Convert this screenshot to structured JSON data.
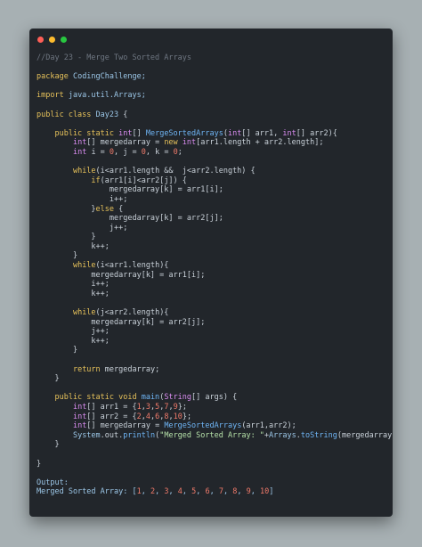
{
  "window": {
    "controls": [
      "close",
      "minimize",
      "maximize"
    ]
  },
  "code": {
    "lines": [
      [
        {
          "t": "//Day 23 - Merge Two Sorted Arrays",
          "c": "cm"
        }
      ],
      [],
      [
        {
          "t": "package ",
          "c": "kw"
        },
        {
          "t": "CodingChallenge;",
          "c": "pl"
        }
      ],
      [],
      [
        {
          "t": "import ",
          "c": "kw"
        },
        {
          "t": "java.util.Arrays;",
          "c": "pl"
        }
      ],
      [],
      [
        {
          "t": "public class ",
          "c": "kw"
        },
        {
          "t": "Day23 ",
          "c": "pl"
        },
        {
          "t": "{",
          "c": "sy"
        }
      ],
      [],
      [
        {
          "t": "    public static ",
          "c": "kw"
        },
        {
          "t": "int",
          "c": "ty"
        },
        {
          "t": "[] ",
          "c": "sy"
        },
        {
          "t": "MergeSortedArrays",
          "c": "fn"
        },
        {
          "t": "(",
          "c": "sy"
        },
        {
          "t": "int",
          "c": "ty"
        },
        {
          "t": "[] arr1, ",
          "c": "sy"
        },
        {
          "t": "int",
          "c": "ty"
        },
        {
          "t": "[] arr2){",
          "c": "sy"
        }
      ],
      [
        {
          "t": "        ",
          "c": "sy"
        },
        {
          "t": "int",
          "c": "ty"
        },
        {
          "t": "[] mergedarray = ",
          "c": "sy"
        },
        {
          "t": "new ",
          "c": "kw"
        },
        {
          "t": "int",
          "c": "ty"
        },
        {
          "t": "[arr1.length + arr2.length];",
          "c": "sy"
        }
      ],
      [
        {
          "t": "        ",
          "c": "sy"
        },
        {
          "t": "int ",
          "c": "ty"
        },
        {
          "t": "i = ",
          "c": "sy"
        },
        {
          "t": "0",
          "c": "nm"
        },
        {
          "t": ", j = ",
          "c": "sy"
        },
        {
          "t": "0",
          "c": "nm"
        },
        {
          "t": ", k = ",
          "c": "sy"
        },
        {
          "t": "0",
          "c": "nm"
        },
        {
          "t": ";",
          "c": "sy"
        }
      ],
      [],
      [
        {
          "t": "        ",
          "c": "sy"
        },
        {
          "t": "while",
          "c": "kw"
        },
        {
          "t": "(i<arr1.length &&  j<arr2.length) {",
          "c": "sy"
        }
      ],
      [
        {
          "t": "            ",
          "c": "sy"
        },
        {
          "t": "if",
          "c": "kw"
        },
        {
          "t": "(arr1[i]<arr2[j]) {",
          "c": "sy"
        }
      ],
      [
        {
          "t": "                mergedarray[k] = arr1[i];",
          "c": "sy"
        }
      ],
      [
        {
          "t": "                i++;",
          "c": "sy"
        }
      ],
      [
        {
          "t": "            }",
          "c": "sy"
        },
        {
          "t": "else",
          "c": "kw"
        },
        {
          "t": " {",
          "c": "sy"
        }
      ],
      [
        {
          "t": "                mergedarray[k] = arr2[j];",
          "c": "sy"
        }
      ],
      [
        {
          "t": "                j++;",
          "c": "sy"
        }
      ],
      [
        {
          "t": "            }",
          "c": "sy"
        }
      ],
      [
        {
          "t": "            k++;",
          "c": "sy"
        }
      ],
      [
        {
          "t": "        }",
          "c": "sy"
        }
      ],
      [
        {
          "t": "        ",
          "c": "sy"
        },
        {
          "t": "while",
          "c": "kw"
        },
        {
          "t": "(i<arr1.length){",
          "c": "sy"
        }
      ],
      [
        {
          "t": "            mergedarray[k] = arr1[i];",
          "c": "sy"
        }
      ],
      [
        {
          "t": "            i++;",
          "c": "sy"
        }
      ],
      [
        {
          "t": "            k++;",
          "c": "sy"
        }
      ],
      [],
      [
        {
          "t": "        ",
          "c": "sy"
        },
        {
          "t": "while",
          "c": "kw"
        },
        {
          "t": "(j<arr2.length){",
          "c": "sy"
        }
      ],
      [
        {
          "t": "            mergedarray[k] = arr2[j];",
          "c": "sy"
        }
      ],
      [
        {
          "t": "            j++;",
          "c": "sy"
        }
      ],
      [
        {
          "t": "            k++;",
          "c": "sy"
        }
      ],
      [
        {
          "t": "        }",
          "c": "sy"
        }
      ],
      [],
      [
        {
          "t": "        ",
          "c": "sy"
        },
        {
          "t": "return ",
          "c": "kw"
        },
        {
          "t": "mergedarray;",
          "c": "sy"
        }
      ],
      [
        {
          "t": "    }",
          "c": "sy"
        }
      ],
      [],
      [
        {
          "t": "    public static void ",
          "c": "kw"
        },
        {
          "t": "main",
          "c": "fn"
        },
        {
          "t": "(",
          "c": "sy"
        },
        {
          "t": "String",
          "c": "ty"
        },
        {
          "t": "[] args) {",
          "c": "sy"
        }
      ],
      [
        {
          "t": "        ",
          "c": "sy"
        },
        {
          "t": "int",
          "c": "ty"
        },
        {
          "t": "[] arr1 = {",
          "c": "sy"
        },
        {
          "t": "1",
          "c": "nm"
        },
        {
          "t": ",",
          "c": "sy"
        },
        {
          "t": "3",
          "c": "nm"
        },
        {
          "t": ",",
          "c": "sy"
        },
        {
          "t": "5",
          "c": "nm"
        },
        {
          "t": ",",
          "c": "sy"
        },
        {
          "t": "7",
          "c": "nm"
        },
        {
          "t": ",",
          "c": "sy"
        },
        {
          "t": "9",
          "c": "nm"
        },
        {
          "t": "};",
          "c": "sy"
        }
      ],
      [
        {
          "t": "        ",
          "c": "sy"
        },
        {
          "t": "int",
          "c": "ty"
        },
        {
          "t": "[] arr2 = {",
          "c": "sy"
        },
        {
          "t": "2",
          "c": "nm"
        },
        {
          "t": ",",
          "c": "sy"
        },
        {
          "t": "4",
          "c": "nm"
        },
        {
          "t": ",",
          "c": "sy"
        },
        {
          "t": "6",
          "c": "nm"
        },
        {
          "t": ",",
          "c": "sy"
        },
        {
          "t": "8",
          "c": "nm"
        },
        {
          "t": ",",
          "c": "sy"
        },
        {
          "t": "10",
          "c": "nm"
        },
        {
          "t": "};",
          "c": "sy"
        }
      ],
      [
        {
          "t": "        ",
          "c": "sy"
        },
        {
          "t": "int",
          "c": "ty"
        },
        {
          "t": "[] mergedarray = ",
          "c": "sy"
        },
        {
          "t": "MergeSortedArrays",
          "c": "fn"
        },
        {
          "t": "(arr1,arr2);",
          "c": "sy"
        }
      ],
      [
        {
          "t": "        ",
          "c": "sy"
        },
        {
          "t": "System",
          "c": "pl"
        },
        {
          "t": ".out.",
          "c": "sy"
        },
        {
          "t": "println",
          "c": "fn"
        },
        {
          "t": "(",
          "c": "sy"
        },
        {
          "t": "\"Merged Sorted Array: \"",
          "c": "st"
        },
        {
          "t": "+",
          "c": "sy"
        },
        {
          "t": "Arrays",
          "c": "pl"
        },
        {
          "t": ".",
          "c": "sy"
        },
        {
          "t": "toString",
          "c": "fn"
        },
        {
          "t": "(mergedarray));",
          "c": "sy"
        }
      ],
      [
        {
          "t": "    }",
          "c": "sy"
        }
      ],
      [],
      [
        {
          "t": "}",
          "c": "sy"
        }
      ],
      [],
      [
        {
          "t": "Output:",
          "c": "pl"
        }
      ],
      [
        {
          "t": "Merged Sorted Array: [",
          "c": "pl"
        },
        {
          "t": "1",
          "c": "nm"
        },
        {
          "t": ", ",
          "c": "pl"
        },
        {
          "t": "2",
          "c": "nm"
        },
        {
          "t": ", ",
          "c": "pl"
        },
        {
          "t": "3",
          "c": "nm"
        },
        {
          "t": ", ",
          "c": "pl"
        },
        {
          "t": "4",
          "c": "nm"
        },
        {
          "t": ", ",
          "c": "pl"
        },
        {
          "t": "5",
          "c": "nm"
        },
        {
          "t": ", ",
          "c": "pl"
        },
        {
          "t": "6",
          "c": "nm"
        },
        {
          "t": ", ",
          "c": "pl"
        },
        {
          "t": "7",
          "c": "nm"
        },
        {
          "t": ", ",
          "c": "pl"
        },
        {
          "t": "8",
          "c": "nm"
        },
        {
          "t": ", ",
          "c": "pl"
        },
        {
          "t": "9",
          "c": "nm"
        },
        {
          "t": ", ",
          "c": "pl"
        },
        {
          "t": "10",
          "c": "nm"
        },
        {
          "t": "]",
          "c": "pl"
        }
      ]
    ]
  },
  "colors": {
    "background": "#a7b0b3",
    "window": "#22262b",
    "close": "#ff5f57",
    "minimize": "#febc2e",
    "maximize": "#28c840",
    "keyword": "#e6c15a",
    "type": "#d98cf0",
    "function": "#6fb5f5",
    "number": "#f07a6a",
    "comment": "#6e7681",
    "string": "#b5e0a8"
  }
}
